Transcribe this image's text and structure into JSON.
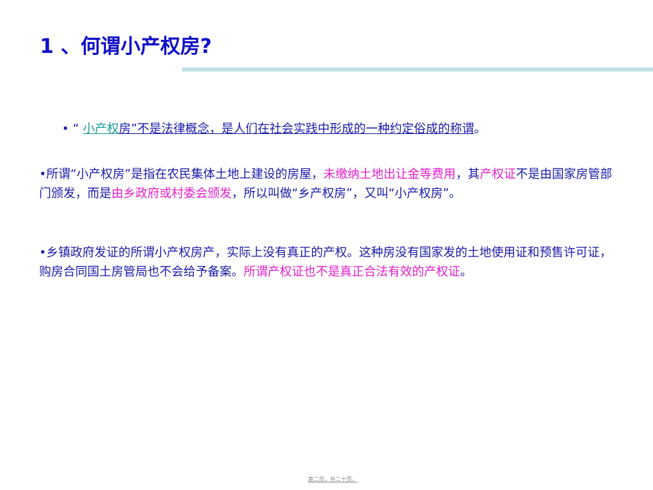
{
  "title": "1 、何谓小产权房?",
  "bullet1": {
    "bullet": "• ",
    "open_quote": "“ ",
    "highlight": "小产权",
    "rest": "房”不是法律概念，是人们在社会实践中形成的一种约定俗成的称谓",
    "end": "。"
  },
  "para2": {
    "a": "•所谓“小产权房”是指在农民集体土地上建设的房屋，",
    "b": "未缴纳土地出让金等费用",
    "c": "，其",
    "d": "产权证",
    "e": "不是由国家房管部门颁发，而是",
    "f": "由乡政府或村委会颁发",
    "g": "，所以叫做“乡产权房”，又叫“小产权房”。"
  },
  "para3": {
    "a": "•乡镇政府发证的所谓小产权房产，实际上没有真正的产权。这种房没有国家发的土地使用证和预售许可证，购房合同国土房管局也不会给予备案。",
    "b": "所谓产权证也不是真正合法有效的产权证",
    "c": "。"
  },
  "footer": "第二页，共二十页。"
}
